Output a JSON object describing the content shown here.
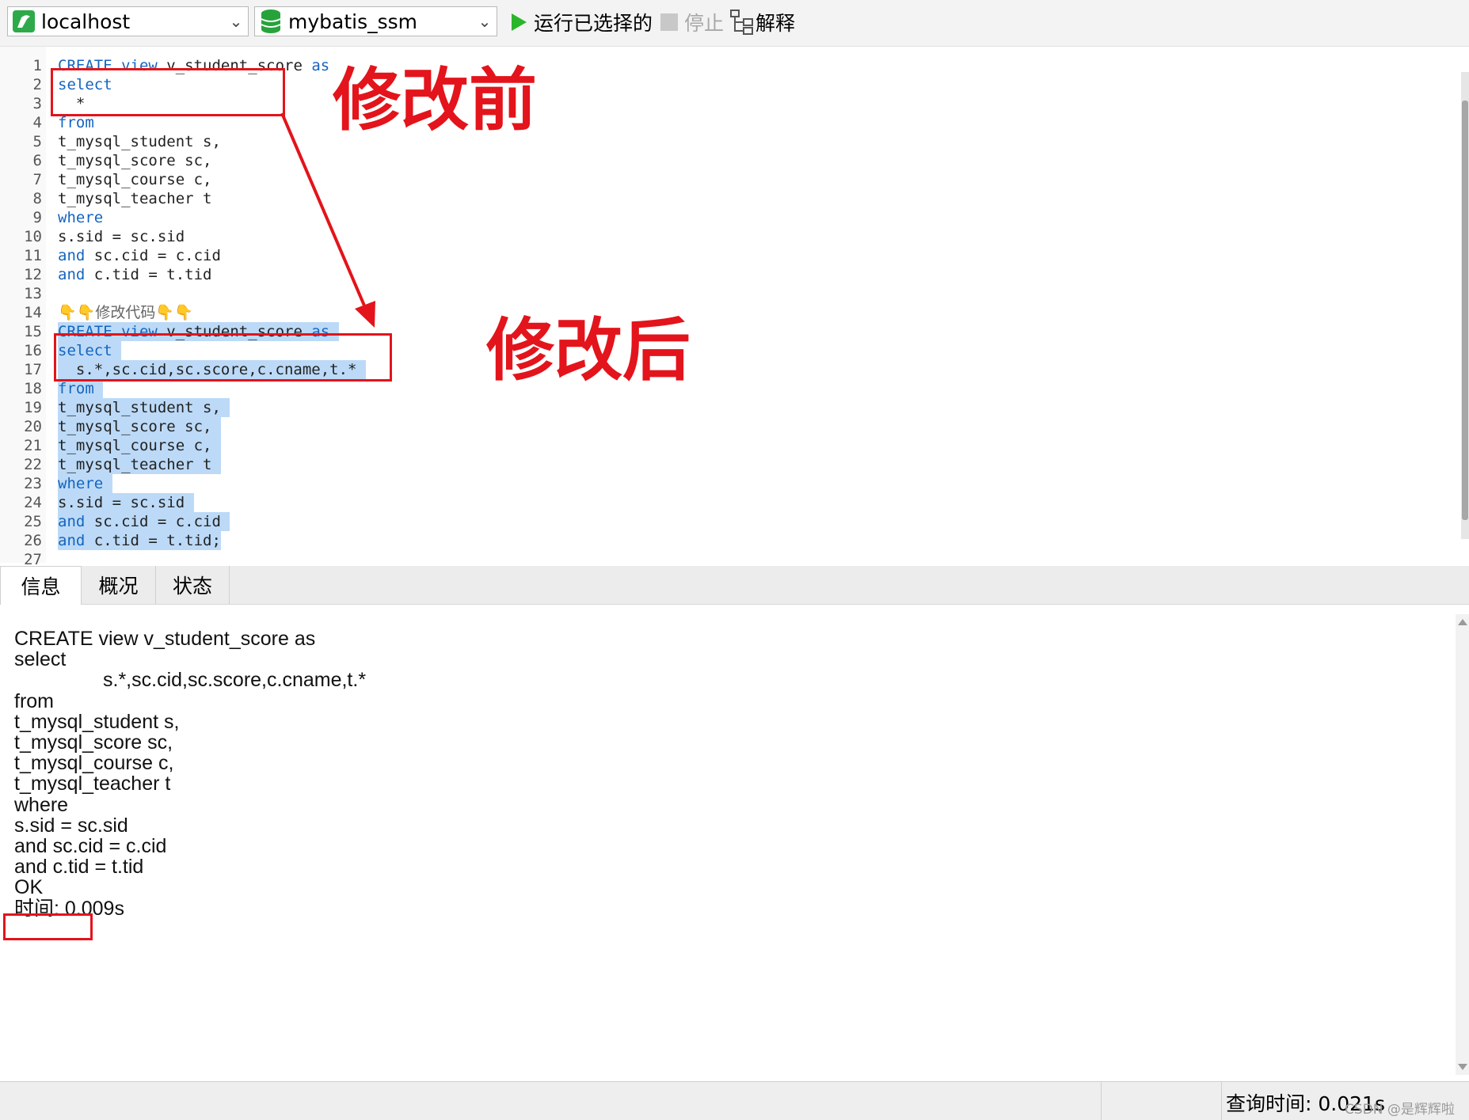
{
  "toolbar": {
    "connection": "localhost",
    "database": "mybatis_ssm",
    "run_selected": "运行已选择的",
    "stop": "停止",
    "explain": "解释",
    "colors": {
      "run": "#2bb52b",
      "db": "#26a33a",
      "connection": "#2eaa4a"
    }
  },
  "editor": {
    "lines": [
      {
        "n": "1",
        "sel": false,
        "tokens": [
          [
            "kw",
            "CREATE"
          ],
          [
            "tx",
            " "
          ],
          [
            "kw",
            "view"
          ],
          [
            "tx",
            " v_student_score "
          ],
          [
            "kw",
            "as"
          ]
        ]
      },
      {
        "n": "2",
        "sel": false,
        "tokens": [
          [
            "kw",
            "select"
          ]
        ]
      },
      {
        "n": "3",
        "sel": false,
        "tokens": [
          [
            "tx",
            "  *"
          ]
        ]
      },
      {
        "n": "4",
        "sel": false,
        "tokens": [
          [
            "kw",
            "from"
          ]
        ]
      },
      {
        "n": "5",
        "sel": false,
        "tokens": [
          [
            "tx",
            "t_mysql_student s,"
          ]
        ]
      },
      {
        "n": "6",
        "sel": false,
        "tokens": [
          [
            "tx",
            "t_mysql_score sc,"
          ]
        ]
      },
      {
        "n": "7",
        "sel": false,
        "tokens": [
          [
            "tx",
            "t_mysql_course c,"
          ]
        ]
      },
      {
        "n": "8",
        "sel": false,
        "tokens": [
          [
            "tx",
            "t_mysql_teacher t"
          ]
        ]
      },
      {
        "n": "9",
        "sel": false,
        "tokens": [
          [
            "kw",
            "where"
          ]
        ]
      },
      {
        "n": "10",
        "sel": false,
        "tokens": [
          [
            "tx",
            "s.sid = sc.sid"
          ]
        ]
      },
      {
        "n": "11",
        "sel": false,
        "tokens": [
          [
            "kw",
            "and"
          ],
          [
            "tx",
            " sc.cid = c.cid"
          ]
        ]
      },
      {
        "n": "12",
        "sel": false,
        "tokens": [
          [
            "kw",
            "and"
          ],
          [
            "tx",
            " c.tid = t.tid"
          ]
        ]
      },
      {
        "n": "13",
        "sel": false,
        "tokens": []
      },
      {
        "n": "14",
        "sel": false,
        "tokens": [
          [
            "cm",
            "👇👇修改代码👇👇"
          ]
        ]
      },
      {
        "n": "15",
        "sel": true,
        "tokens": [
          [
            "kw",
            "CREATE"
          ],
          [
            "tx",
            " "
          ],
          [
            "kw",
            "view"
          ],
          [
            "tx",
            " v_student_score "
          ],
          [
            "kw",
            "as"
          ],
          [
            "tx",
            " "
          ]
        ]
      },
      {
        "n": "16",
        "sel": true,
        "tokens": [
          [
            "kw",
            "select"
          ],
          [
            "tx",
            " "
          ]
        ]
      },
      {
        "n": "17",
        "sel": true,
        "tokens": [
          [
            "tx",
            "  s.*,sc.cid,sc.score,c.cname,t.* "
          ]
        ]
      },
      {
        "n": "18",
        "sel": true,
        "tokens": [
          [
            "kw",
            "from"
          ],
          [
            "tx",
            " "
          ]
        ]
      },
      {
        "n": "19",
        "sel": true,
        "tokens": [
          [
            "tx",
            "t_mysql_student s, "
          ]
        ]
      },
      {
        "n": "20",
        "sel": true,
        "tokens": [
          [
            "tx",
            "t_mysql_score sc, "
          ]
        ]
      },
      {
        "n": "21",
        "sel": true,
        "tokens": [
          [
            "tx",
            "t_mysql_course c, "
          ]
        ]
      },
      {
        "n": "22",
        "sel": true,
        "tokens": [
          [
            "tx",
            "t_mysql_teacher t "
          ]
        ]
      },
      {
        "n": "23",
        "sel": true,
        "tokens": [
          [
            "kw",
            "where"
          ],
          [
            "tx",
            " "
          ]
        ]
      },
      {
        "n": "24",
        "sel": true,
        "tokens": [
          [
            "tx",
            "s.sid = sc.sid "
          ]
        ]
      },
      {
        "n": "25",
        "sel": true,
        "tokens": [
          [
            "kw",
            "and"
          ],
          [
            "tx",
            " sc.cid = c.cid "
          ]
        ]
      },
      {
        "n": "26",
        "sel": true,
        "tokens": [
          [
            "kw",
            "and"
          ],
          [
            "tx",
            " c.tid = t.tid;"
          ]
        ]
      },
      {
        "n": "27",
        "sel": false,
        "tokens": []
      }
    ]
  },
  "tabs": [
    "信息",
    "概况",
    "状态"
  ],
  "message": [
    "CREATE view v_student_score as",
    "select",
    "\t\ts.*,sc.cid,sc.score,c.cname,t.*",
    "from",
    "t_mysql_student s,",
    "t_mysql_score sc,",
    "t_mysql_course c,",
    "t_mysql_teacher t",
    "where",
    "s.sid = sc.sid",
    "and sc.cid = c.cid",
    "and c.tid = t.tid",
    "OK",
    "时间: 0.009s"
  ],
  "status": {
    "query_time": "查询时间: 0.021s",
    "watermark": "CSDN @是辉辉啦"
  },
  "annotations": {
    "before": "修改前",
    "after": "修改后",
    "color": "#e3141b"
  }
}
